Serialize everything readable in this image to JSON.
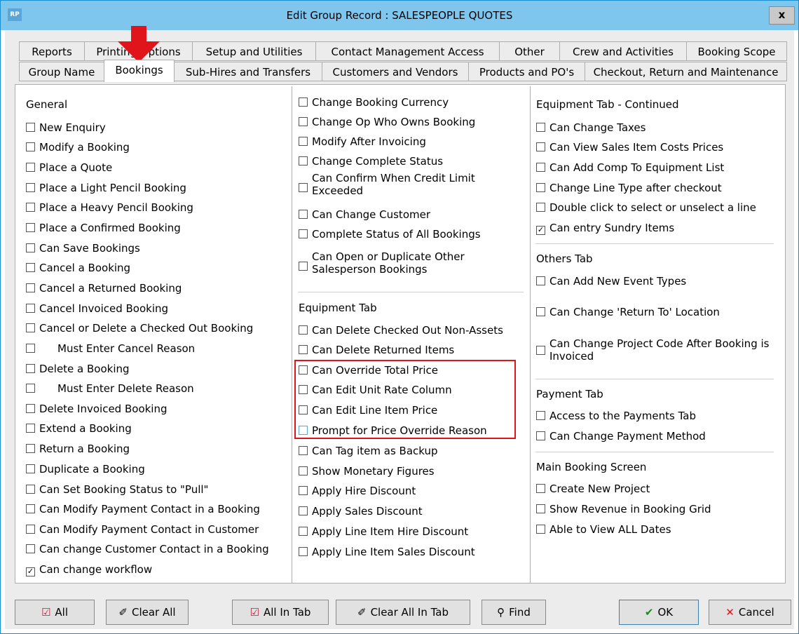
{
  "window": {
    "title": "Edit Group Record : SALESPEOPLE QUOTES",
    "logo": "RP",
    "close": "x"
  },
  "tabs_row1": [
    "Reports",
    "Printing Options",
    "Setup and Utilities",
    "Contact Management Access",
    "Other",
    "Crew and Activities",
    "Booking Scope"
  ],
  "tabs_row2": [
    "Group Name",
    "Bookings",
    "Sub-Hires and Transfers",
    "Customers and Vendors",
    "Products and PO's",
    "Checkout, Return and Maintenance"
  ],
  "col1": {
    "heading": "General",
    "items": [
      "New Enquiry",
      "Modify a Booking",
      "Place a Quote",
      "Place a Light Pencil Booking",
      "Place a Heavy Pencil Booking",
      "Place a Confirmed Booking",
      "Can Save Bookings",
      "Cancel a Booking",
      "Cancel a Returned Booking",
      "Cancel Invoiced Booking",
      "Cancel or Delete a Checked Out Booking",
      "Must Enter Cancel Reason",
      "Delete a Booking",
      "Must Enter Delete Reason",
      "Delete Invoiced Booking",
      "Extend a Booking",
      "Return a Booking",
      "Duplicate a Booking",
      "Can Set Booking Status to \"Pull\"",
      "Can Modify Payment Contact in a Booking",
      "Can Modify Payment Contact in Customer",
      "Can change Customer Contact in a Booking",
      "Can change workflow"
    ]
  },
  "col2": {
    "items_top": [
      "Change Booking Currency",
      "Change Op Who Owns Booking",
      "Modify After Invoicing",
      "Change Complete Status",
      "Can Confirm When Credit Limit Exceeded",
      "Can Change Customer",
      "Complete Status of All Bookings",
      "Can Open or Duplicate Other Salesperson Bookings"
    ],
    "heading": "Equipment Tab",
    "items_equip": [
      "Can Delete Checked Out Non-Assets",
      "Can Delete Returned Items",
      "Can Override Total Price",
      "Can Edit Unit Rate Column",
      "Can Edit Line Item Price",
      "Prompt for Price Override Reason",
      "Can Tag item as Backup",
      "Show Monetary Figures",
      "Apply Hire Discount",
      "Apply Sales Discount",
      "Apply Line Item Hire Discount",
      "Apply Line Item Sales Discount"
    ]
  },
  "col3": {
    "heading1": "Equipment Tab - Continued",
    "items1": [
      "Can Change Taxes",
      "Can View Sales Item Costs Prices",
      "Can Add Comp To Equipment List",
      "Change Line Type after checkout",
      "Double click to select or unselect a line",
      "Can entry Sundry Items"
    ],
    "heading2": "Others Tab",
    "items2": [
      "Can Add New Event Types",
      "Can Change 'Return To' Location",
      "Can Change Project Code After Booking is Invoiced"
    ],
    "heading3": "Payment Tab",
    "items3": [
      "Access to the Payments Tab",
      "Can Change Payment Method"
    ],
    "heading4": "Main Booking Screen",
    "items4": [
      "Create New Project",
      "Show Revenue in Booking Grid",
      "Able to View ALL Dates"
    ]
  },
  "buttons": {
    "all": "All",
    "clear_all": "Clear All",
    "all_in_tab": "All In Tab",
    "clear_all_in_tab": "Clear All In Tab",
    "find": "Find",
    "ok": "OK",
    "cancel": "Cancel"
  },
  "colors": {
    "titlebar": "#7fc6ee",
    "highlight": "#e0141b",
    "ok_check": "#1a8a1a"
  }
}
